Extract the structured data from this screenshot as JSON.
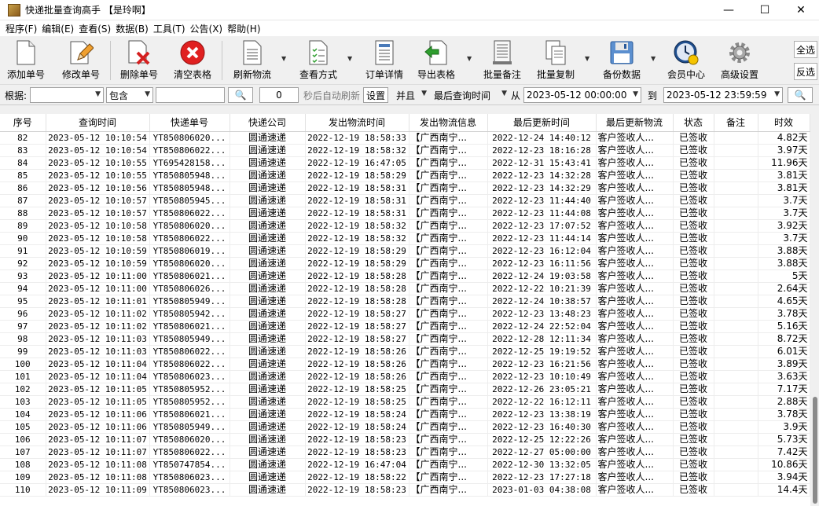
{
  "window": {
    "title": "快递批量查询高手 【是玲啊】",
    "minimize": "—",
    "maximize": "☐",
    "close": "✕"
  },
  "menu": [
    "程序(F)",
    "编辑(E)",
    "查看(S)",
    "数据(B)",
    "工具(T)",
    "公告(X)",
    "帮助(H)"
  ],
  "toolbar": {
    "add": "添加单号",
    "edit": "修改单号",
    "delete": "删除单号",
    "clear": "清空表格",
    "refresh": "刷新物流",
    "view_mode": "查看方式",
    "order_detail": "订单详情",
    "export": "导出表格",
    "batch_note": "批量备注",
    "batch_copy": "批量复制",
    "backup": "备份数据",
    "member": "会员中心",
    "advanced": "高级设置",
    "select_all": "全选",
    "invert": "反选"
  },
  "filter": {
    "according_label": "根据:",
    "field_value": "",
    "match_mode": "包含",
    "keyword": "",
    "seconds": "0",
    "auto_refresh_label": "秒后自动刷新",
    "set_button": "设置",
    "logic": "并且",
    "time_field": "最后查询时间",
    "from_label": "从",
    "from_date": "2023-05-12 00:00:00",
    "to_label": "到",
    "to_date": "2023-05-12 23:59:59"
  },
  "table": {
    "headers": [
      "序号",
      "查询时间",
      "快递单号",
      "快递公司",
      "发出物流时间",
      "发出物流信息",
      "最后更新时间",
      "最后更新物流",
      "状态",
      "备注",
      "时效"
    ],
    "rows": [
      [
        "82",
        "2023-05-12 10:10:54",
        "YT850806020...",
        "圆通速递",
        "2022-12-19 18:58:33",
        "【广西南宁...",
        "2022-12-24 14:40:12",
        "客户签收人...",
        "已签收",
        "",
        "4.82天"
      ],
      [
        "83",
        "2023-05-12 10:10:54",
        "YT850806022...",
        "圆通速递",
        "2022-12-19 18:58:32",
        "【广西南宁...",
        "2022-12-23 18:16:28",
        "客户签收人...",
        "已签收",
        "",
        "3.97天"
      ],
      [
        "84",
        "2023-05-12 10:10:55",
        "YT695428158...",
        "圆通速递",
        "2022-12-19 16:47:05",
        "【广西南宁...",
        "2022-12-31 15:43:41",
        "客户签收人...",
        "已签收",
        "",
        "11.96天"
      ],
      [
        "85",
        "2023-05-12 10:10:55",
        "YT850805948...",
        "圆通速递",
        "2022-12-19 18:58:29",
        "【广西南宁...",
        "2022-12-23 14:32:28",
        "客户签收人...",
        "已签收",
        "",
        "3.81天"
      ],
      [
        "86",
        "2023-05-12 10:10:56",
        "YT850805948...",
        "圆通速递",
        "2022-12-19 18:58:31",
        "【广西南宁...",
        "2022-12-23 14:32:29",
        "客户签收人...",
        "已签收",
        "",
        "3.81天"
      ],
      [
        "87",
        "2023-05-12 10:10:57",
        "YT850805945...",
        "圆通速递",
        "2022-12-19 18:58:31",
        "【广西南宁...",
        "2022-12-23 11:44:40",
        "客户签收人...",
        "已签收",
        "",
        "3.7天"
      ],
      [
        "88",
        "2023-05-12 10:10:57",
        "YT850806022...",
        "圆通速递",
        "2022-12-19 18:58:31",
        "【广西南宁...",
        "2022-12-23 11:44:08",
        "客户签收人...",
        "已签收",
        "",
        "3.7天"
      ],
      [
        "89",
        "2023-05-12 10:10:58",
        "YT850806020...",
        "圆通速递",
        "2022-12-19 18:58:32",
        "【广西南宁...",
        "2022-12-23 17:07:52",
        "客户签收人...",
        "已签收",
        "",
        "3.92天"
      ],
      [
        "90",
        "2023-05-12 10:10:58",
        "YT850806022...",
        "圆通速递",
        "2022-12-19 18:58:32",
        "【广西南宁...",
        "2022-12-23 11:44:14",
        "客户签收人...",
        "已签收",
        "",
        "3.7天"
      ],
      [
        "91",
        "2023-05-12 10:10:59",
        "YT850806019...",
        "圆通速递",
        "2022-12-19 18:58:29",
        "【广西南宁...",
        "2022-12-23 16:12:04",
        "客户签收人...",
        "已签收",
        "",
        "3.88天"
      ],
      [
        "92",
        "2023-05-12 10:10:59",
        "YT850806020...",
        "圆通速递",
        "2022-12-19 18:58:29",
        "【广西南宁...",
        "2022-12-23 16:11:56",
        "客户签收人...",
        "已签收",
        "",
        "3.88天"
      ],
      [
        "93",
        "2023-05-12 10:11:00",
        "YT850806021...",
        "圆通速递",
        "2022-12-19 18:58:28",
        "【广西南宁...",
        "2022-12-24 19:03:58",
        "客户签收人...",
        "已签收",
        "",
        "5天"
      ],
      [
        "94",
        "2023-05-12 10:11:00",
        "YT850806026...",
        "圆通速递",
        "2022-12-19 18:58:28",
        "【广西南宁...",
        "2022-12-22 10:21:39",
        "客户签收人...",
        "已签收",
        "",
        "2.64天"
      ],
      [
        "95",
        "2023-05-12 10:11:01",
        "YT850805949...",
        "圆通速递",
        "2022-12-19 18:58:28",
        "【广西南宁...",
        "2022-12-24 10:38:57",
        "客户签收人...",
        "已签收",
        "",
        "4.65天"
      ],
      [
        "96",
        "2023-05-12 10:11:02",
        "YT850805942...",
        "圆通速递",
        "2022-12-19 18:58:27",
        "【广西南宁...",
        "2022-12-23 13:48:23",
        "客户签收人...",
        "已签收",
        "",
        "3.78天"
      ],
      [
        "97",
        "2023-05-12 10:11:02",
        "YT850806021...",
        "圆通速递",
        "2022-12-19 18:58:27",
        "【广西南宁...",
        "2022-12-24 22:52:04",
        "客户签收人...",
        "已签收",
        "",
        "5.16天"
      ],
      [
        "98",
        "2023-05-12 10:11:03",
        "YT850805949...",
        "圆通速递",
        "2022-12-19 18:58:27",
        "【广西南宁...",
        "2022-12-28 12:11:34",
        "客户签收人...",
        "已签收",
        "",
        "8.72天"
      ],
      [
        "99",
        "2023-05-12 10:11:03",
        "YT850806022...",
        "圆通速递",
        "2022-12-19 18:58:26",
        "【广西南宁...",
        "2022-12-25 19:19:52",
        "客户签收人...",
        "已签收",
        "",
        "6.01天"
      ],
      [
        "100",
        "2023-05-12 10:11:04",
        "YT850806022...",
        "圆通速递",
        "2022-12-19 18:58:26",
        "【广西南宁...",
        "2022-12-23 16:21:56",
        "客户签收人...",
        "已签收",
        "",
        "3.89天"
      ],
      [
        "101",
        "2023-05-12 10:11:04",
        "YT850806023...",
        "圆通速递",
        "2022-12-19 18:58:26",
        "【广西南宁...",
        "2022-12-23 10:10:49",
        "客户签收人...",
        "已签收",
        "",
        "3.63天"
      ],
      [
        "102",
        "2023-05-12 10:11:05",
        "YT850805952...",
        "圆通速递",
        "2022-12-19 18:58:25",
        "【广西南宁...",
        "2022-12-26 23:05:21",
        "客户签收人...",
        "已签收",
        "",
        "7.17天"
      ],
      [
        "103",
        "2023-05-12 10:11:05",
        "YT850805952...",
        "圆通速递",
        "2022-12-19 18:58:25",
        "【广西南宁...",
        "2022-12-22 16:12:11",
        "客户签收人...",
        "已签收",
        "",
        "2.88天"
      ],
      [
        "104",
        "2023-05-12 10:11:06",
        "YT850806021...",
        "圆通速递",
        "2022-12-19 18:58:24",
        "【广西南宁...",
        "2022-12-23 13:38:19",
        "客户签收人...",
        "已签收",
        "",
        "3.78天"
      ],
      [
        "105",
        "2023-05-12 10:11:06",
        "YT850805949...",
        "圆通速递",
        "2022-12-19 18:58:24",
        "【广西南宁...",
        "2022-12-23 16:40:30",
        "客户签收人...",
        "已签收",
        "",
        "3.9天"
      ],
      [
        "106",
        "2023-05-12 10:11:07",
        "YT850806020...",
        "圆通速递",
        "2022-12-19 18:58:23",
        "【广西南宁...",
        "2022-12-25 12:22:26",
        "客户签收人...",
        "已签收",
        "",
        "5.73天"
      ],
      [
        "107",
        "2023-05-12 10:11:07",
        "YT850806022...",
        "圆通速递",
        "2022-12-19 18:58:23",
        "【广西南宁...",
        "2022-12-27 05:00:00",
        "客户签收人...",
        "已签收",
        "",
        "7.42天"
      ],
      [
        "108",
        "2023-05-12 10:11:08",
        "YT850747854...",
        "圆通速递",
        "2022-12-19 16:47:04",
        "【广西南宁...",
        "2022-12-30 13:32:05",
        "客户签收人...",
        "已签收",
        "",
        "10.86天"
      ],
      [
        "109",
        "2023-05-12 10:11:08",
        "YT850806023...",
        "圆通速递",
        "2022-12-19 18:58:22",
        "【广西南宁...",
        "2022-12-23 17:27:18",
        "客户签收人...",
        "已签收",
        "",
        "3.94天"
      ],
      [
        "110",
        "2023-05-12 10:11:09",
        "YT850806023...",
        "圆通速递",
        "2022-12-19 18:58:23",
        "【广西南宁...",
        "2023-01-03 04:38:08",
        "客户签收人...",
        "已签收",
        "",
        "14.4天"
      ]
    ]
  },
  "colors": {
    "accent": "#0078d7",
    "delete_red": "#d42020",
    "export_green": "#2e9e2e"
  }
}
